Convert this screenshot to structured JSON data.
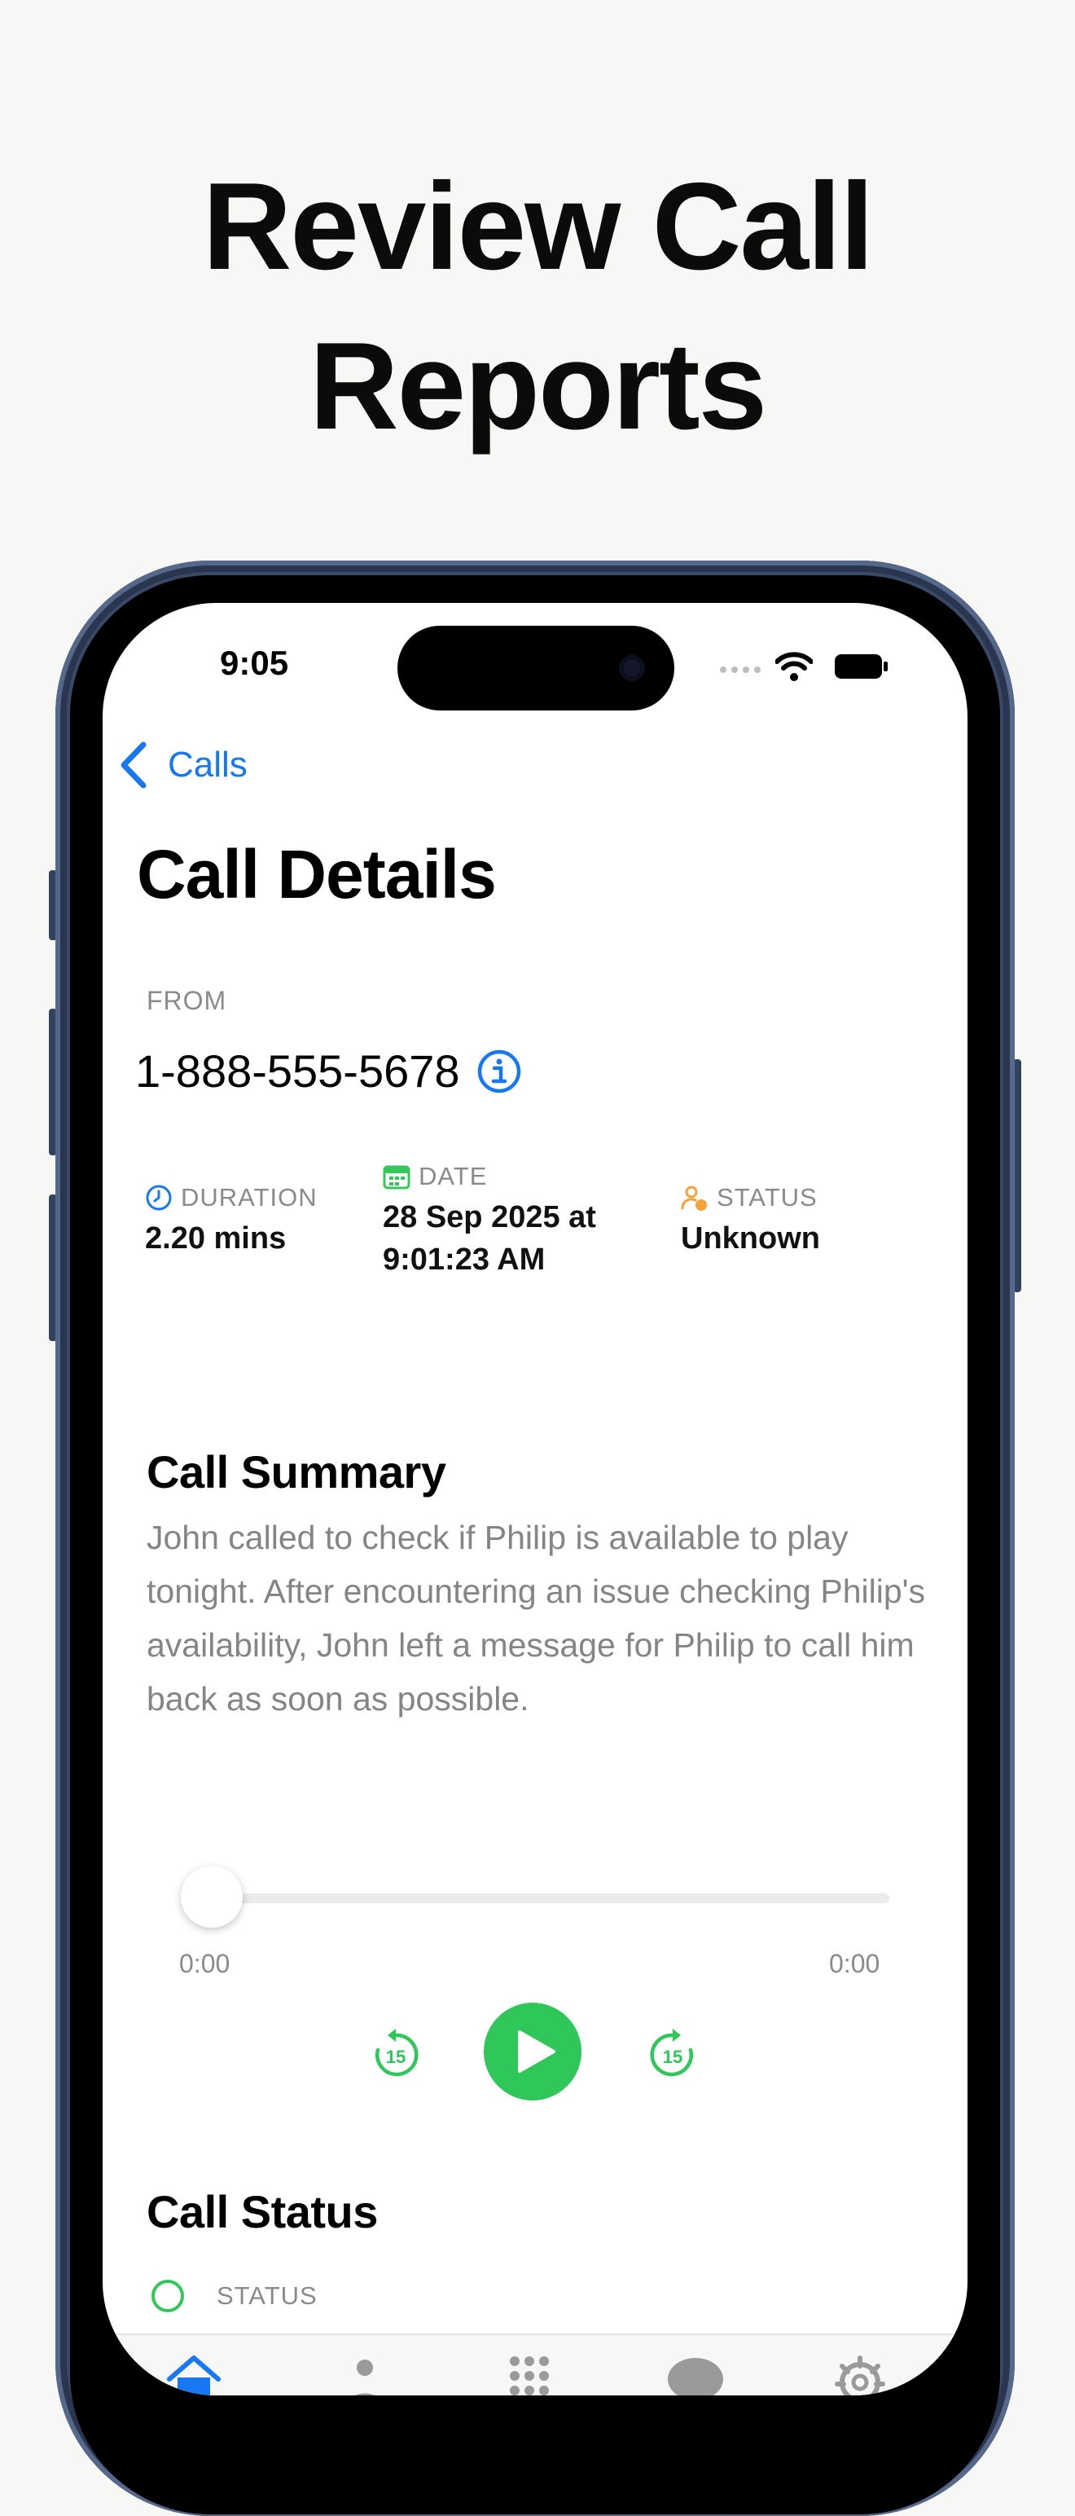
{
  "headline": {
    "line1": "Review Call",
    "line2": "Reports"
  },
  "status_bar": {
    "time": "9:05"
  },
  "nav": {
    "back_label": "Calls",
    "title": "Call Details"
  },
  "from": {
    "label": "FROM",
    "number": "1-888-555-5678"
  },
  "stats": {
    "duration": {
      "label": "DURATION",
      "value": "2.20 mins"
    },
    "date": {
      "label": "DATE",
      "value_line1": "28 Sep 2025 at",
      "value_line2": "9:01:23 AM"
    },
    "status": {
      "label": "STATUS",
      "value": "Unknown"
    }
  },
  "summary": {
    "title": "Call Summary",
    "text": "John called to check if Philip is available to play tonight. After encountering an issue checking Philip's availability, John left a message for Philip to call him back as soon as possible."
  },
  "player": {
    "current_time": "0:00",
    "total_time": "0:00",
    "skip_back_seconds": "15",
    "skip_forward_seconds": "15",
    "progress": 0
  },
  "call_status": {
    "title": "Call Status",
    "status_label": "STATUS"
  },
  "tabs": [
    {
      "icon": "home-icon",
      "active": true
    },
    {
      "icon": "person-icon",
      "active": false
    },
    {
      "icon": "keypad-icon",
      "active": false
    },
    {
      "icon": "message-icon",
      "active": false
    },
    {
      "icon": "gear-icon",
      "active": false
    }
  ],
  "colors": {
    "accent_blue": "#1877f2",
    "play_green": "#2fc65a",
    "date_green": "#34c759",
    "status_orange": "#f2a33a",
    "frame": "#3a4a66"
  }
}
